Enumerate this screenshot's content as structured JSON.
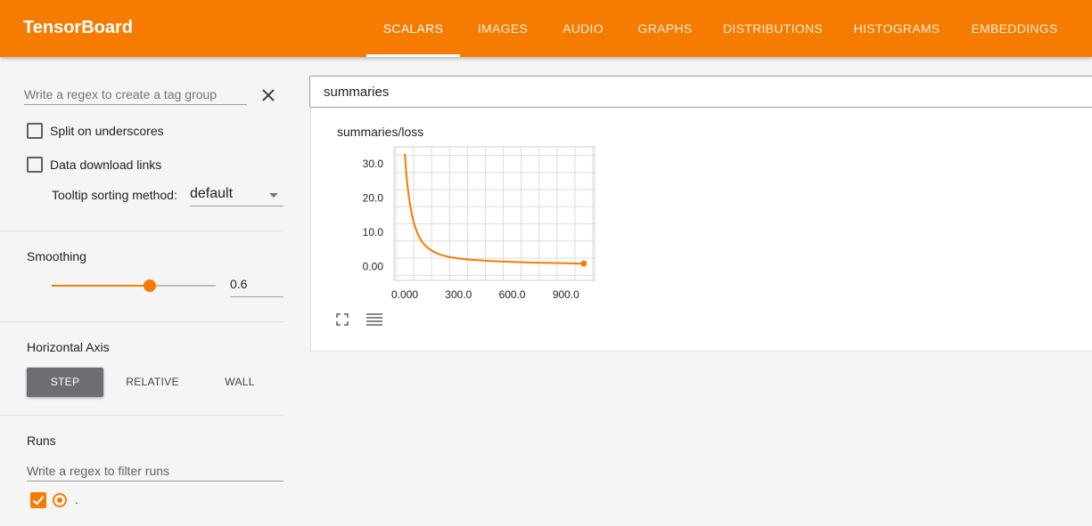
{
  "header": {
    "brand": "TensorBoard",
    "tabs": [
      {
        "label": "SCALARS",
        "active": true
      },
      {
        "label": "IMAGES",
        "active": false
      },
      {
        "label": "AUDIO",
        "active": false
      },
      {
        "label": "GRAPHS",
        "active": false
      },
      {
        "label": "DISTRIBUTIONS",
        "active": false
      },
      {
        "label": "HISTOGRAMS",
        "active": false
      },
      {
        "label": "EMBEDDINGS",
        "active": false
      }
    ],
    "color": "#f57c00"
  },
  "sidebar": {
    "tag_group_placeholder": "Write a regex to create a tag group",
    "split_label": "Split on underscores",
    "split_checked": false,
    "download_label": "Data download links",
    "download_checked": false,
    "tooltip_label": "Tooltip sorting method:",
    "tooltip_value": "default",
    "smoothing_title": "Smoothing",
    "smoothing_value": "0.6",
    "axis_title": "Horizontal Axis",
    "axis_options": [
      "STEP",
      "RELATIVE",
      "WALL"
    ],
    "axis_selected": "STEP",
    "runs_title": "Runs",
    "runs_placeholder": "Write a regex to filter runs",
    "runs": [
      {
        "name": ".",
        "checked": true,
        "selected": true
      }
    ]
  },
  "main": {
    "search_value": "summaries"
  },
  "chart_data": {
    "type": "line",
    "title": "summaries/loss",
    "xlim": [
      -60,
      1060
    ],
    "ylim": [
      -4,
      35
    ],
    "x_ticks": [
      "0.000",
      "300.0",
      "600.0",
      "900.0"
    ],
    "y_ticks": [
      "0.00",
      "10.0",
      "20.0",
      "30.0"
    ],
    "grid": true,
    "series": [
      {
        "color": "#f57c00",
        "x": [
          0,
          10,
          20,
          30,
          40,
          50,
          60,
          80,
          100,
          125,
          150,
          175,
          200,
          250,
          300,
          350,
          400,
          500,
          600,
          700,
          800,
          900,
          1000
        ],
        "y": [
          33.0,
          26.0,
          21.5,
          18.0,
          15.2,
          13.0,
          11.3,
          8.7,
          7.0,
          5.6,
          4.7,
          4.0,
          3.5,
          2.8,
          2.4,
          2.1,
          1.9,
          1.6,
          1.4,
          1.2,
          1.1,
          1.0,
          0.9
        ]
      }
    ]
  }
}
